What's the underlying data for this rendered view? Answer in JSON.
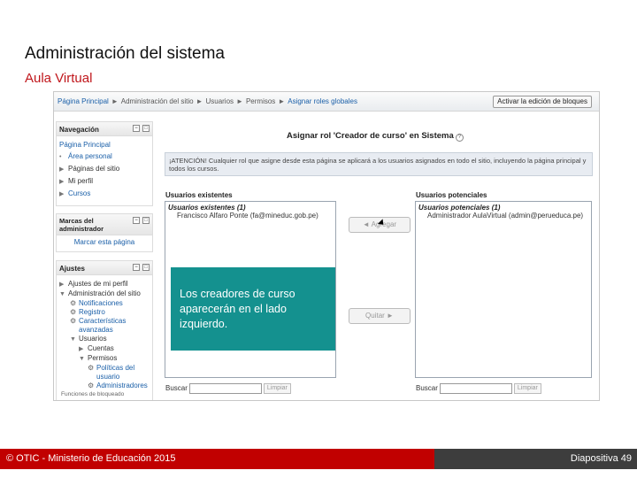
{
  "slide": {
    "title": "Administración del sistema",
    "subtitle": "Aula Virtual",
    "callout": "Los creadores de curso aparecerán en el lado izquierdo.",
    "footer_left": "© OTIC - Ministerio de Educación 2015",
    "footer_right": "Diapositiva 49"
  },
  "breadcrumb": {
    "items": [
      "Página Principal",
      "Administración del sitio",
      "Usuarios",
      "Permisos",
      "Asignar roles globales"
    ],
    "separator": "►"
  },
  "blocks_button": "Activar la edición de bloques",
  "nav_block": {
    "title": "Navegación",
    "home": "Página Principal",
    "items": [
      "Área personal",
      "Páginas del sitio",
      "Mi perfil",
      "Cursos"
    ]
  },
  "admin_block": {
    "title": "Marcas del administrador",
    "link": "Marcar esta página"
  },
  "settings_block": {
    "title": "Ajustes",
    "items": [
      "Ajustes de mi perfil",
      "Administración del sitio",
      "Notificaciones",
      "Registro",
      "Características avanzadas",
      "Usuarios",
      "Cuentas",
      "Permisos",
      "Políticas del usuario",
      "Administradores"
    ],
    "more": "Funciones de bloqueado"
  },
  "dialog": {
    "title": "Asignar rol 'Creador de curso' en Sistema",
    "warning": "¡ATENCIÓN! Cualquier rol que asigne desde esta página se aplicará a los usuarios asignados en todo el sitio, incluyendo la página principal y todos los cursos."
  },
  "existing": {
    "label": "Usuarios existentes",
    "group": "Usuarios existentes (1)",
    "options": [
      "Francisco Alfaro Ponte (fa@mineduc.gob.pe)"
    ]
  },
  "potential": {
    "label": "Usuarios potenciales",
    "group": "Usuarios potenciales (1)",
    "options": [
      "Administrador AulaVirtual (admin@perueduca.pe)"
    ]
  },
  "buttons": {
    "add": "◄ Agregar",
    "remove": "Quitar ►"
  },
  "search": {
    "label": "Buscar",
    "clear": "Limpiar"
  },
  "colors": {
    "footer_red": "#c10000",
    "footer_dark": "#3d3d3d",
    "callout_teal": "#14918f",
    "subtitle_red": "#c0161b",
    "link_blue": "#1a5fa8"
  }
}
